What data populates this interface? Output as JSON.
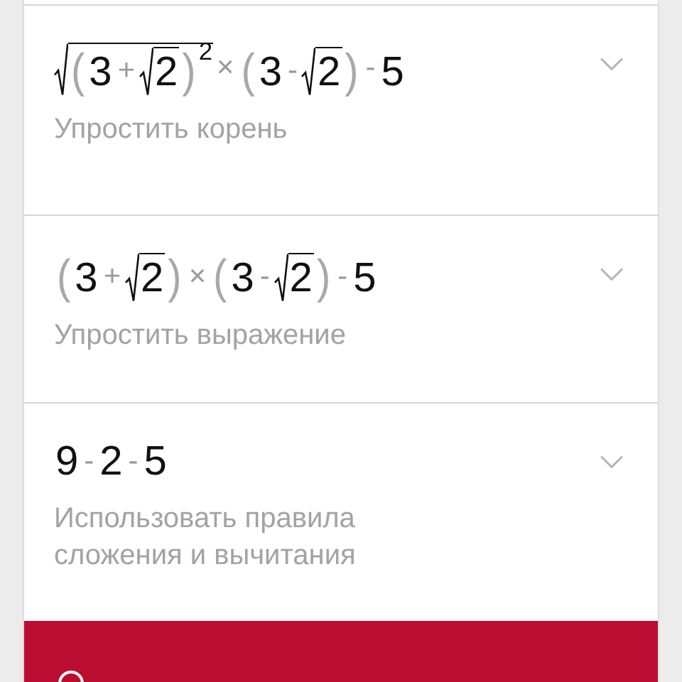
{
  "steps": [
    {
      "expanded": false,
      "description": "Упростить корень",
      "expression": [
        {
          "kind": "sqrt",
          "children": [
            {
              "kind": "group",
              "open": "(",
              "close": ")",
              "power": "2",
              "children": [
                {
                  "kind": "num",
                  "text": "3"
                },
                {
                  "kind": "op",
                  "text": "+"
                },
                {
                  "kind": "sqrt",
                  "children": [
                    {
                      "kind": "num",
                      "text": "2"
                    }
                  ]
                }
              ]
            }
          ]
        },
        {
          "kind": "op",
          "text": "×"
        },
        {
          "kind": "group",
          "open": "(",
          "close": ")",
          "children": [
            {
              "kind": "num",
              "text": "3"
            },
            {
              "kind": "op",
              "text": "-"
            },
            {
              "kind": "sqrt",
              "children": [
                {
                  "kind": "num",
                  "text": "2"
                }
              ]
            }
          ]
        },
        {
          "kind": "op",
          "text": "-"
        },
        {
          "kind": "num",
          "text": "5"
        }
      ]
    },
    {
      "expanded": false,
      "description": "Упростить выражение",
      "expression": [
        {
          "kind": "group",
          "open": "(",
          "close": ")",
          "children": [
            {
              "kind": "num",
              "text": "3"
            },
            {
              "kind": "op",
              "text": "+"
            },
            {
              "kind": "sqrt",
              "children": [
                {
                  "kind": "num",
                  "text": "2"
                }
              ]
            }
          ]
        },
        {
          "kind": "op",
          "text": "×"
        },
        {
          "kind": "group",
          "open": "(",
          "close": ")",
          "children": [
            {
              "kind": "num",
              "text": "3"
            },
            {
              "kind": "op",
              "text": "-"
            },
            {
              "kind": "sqrt",
              "children": [
                {
                  "kind": "num",
                  "text": "2"
                }
              ]
            }
          ]
        },
        {
          "kind": "op",
          "text": "-"
        },
        {
          "kind": "num",
          "text": "5"
        }
      ]
    },
    {
      "expanded": false,
      "description": "Использовать правила сложения и вычитания",
      "expression": [
        {
          "kind": "num",
          "text": "9"
        },
        {
          "kind": "op",
          "text": "-"
        },
        {
          "kind": "num",
          "text": "2"
        },
        {
          "kind": "op",
          "text": "-"
        },
        {
          "kind": "num",
          "text": "5"
        }
      ]
    }
  ]
}
